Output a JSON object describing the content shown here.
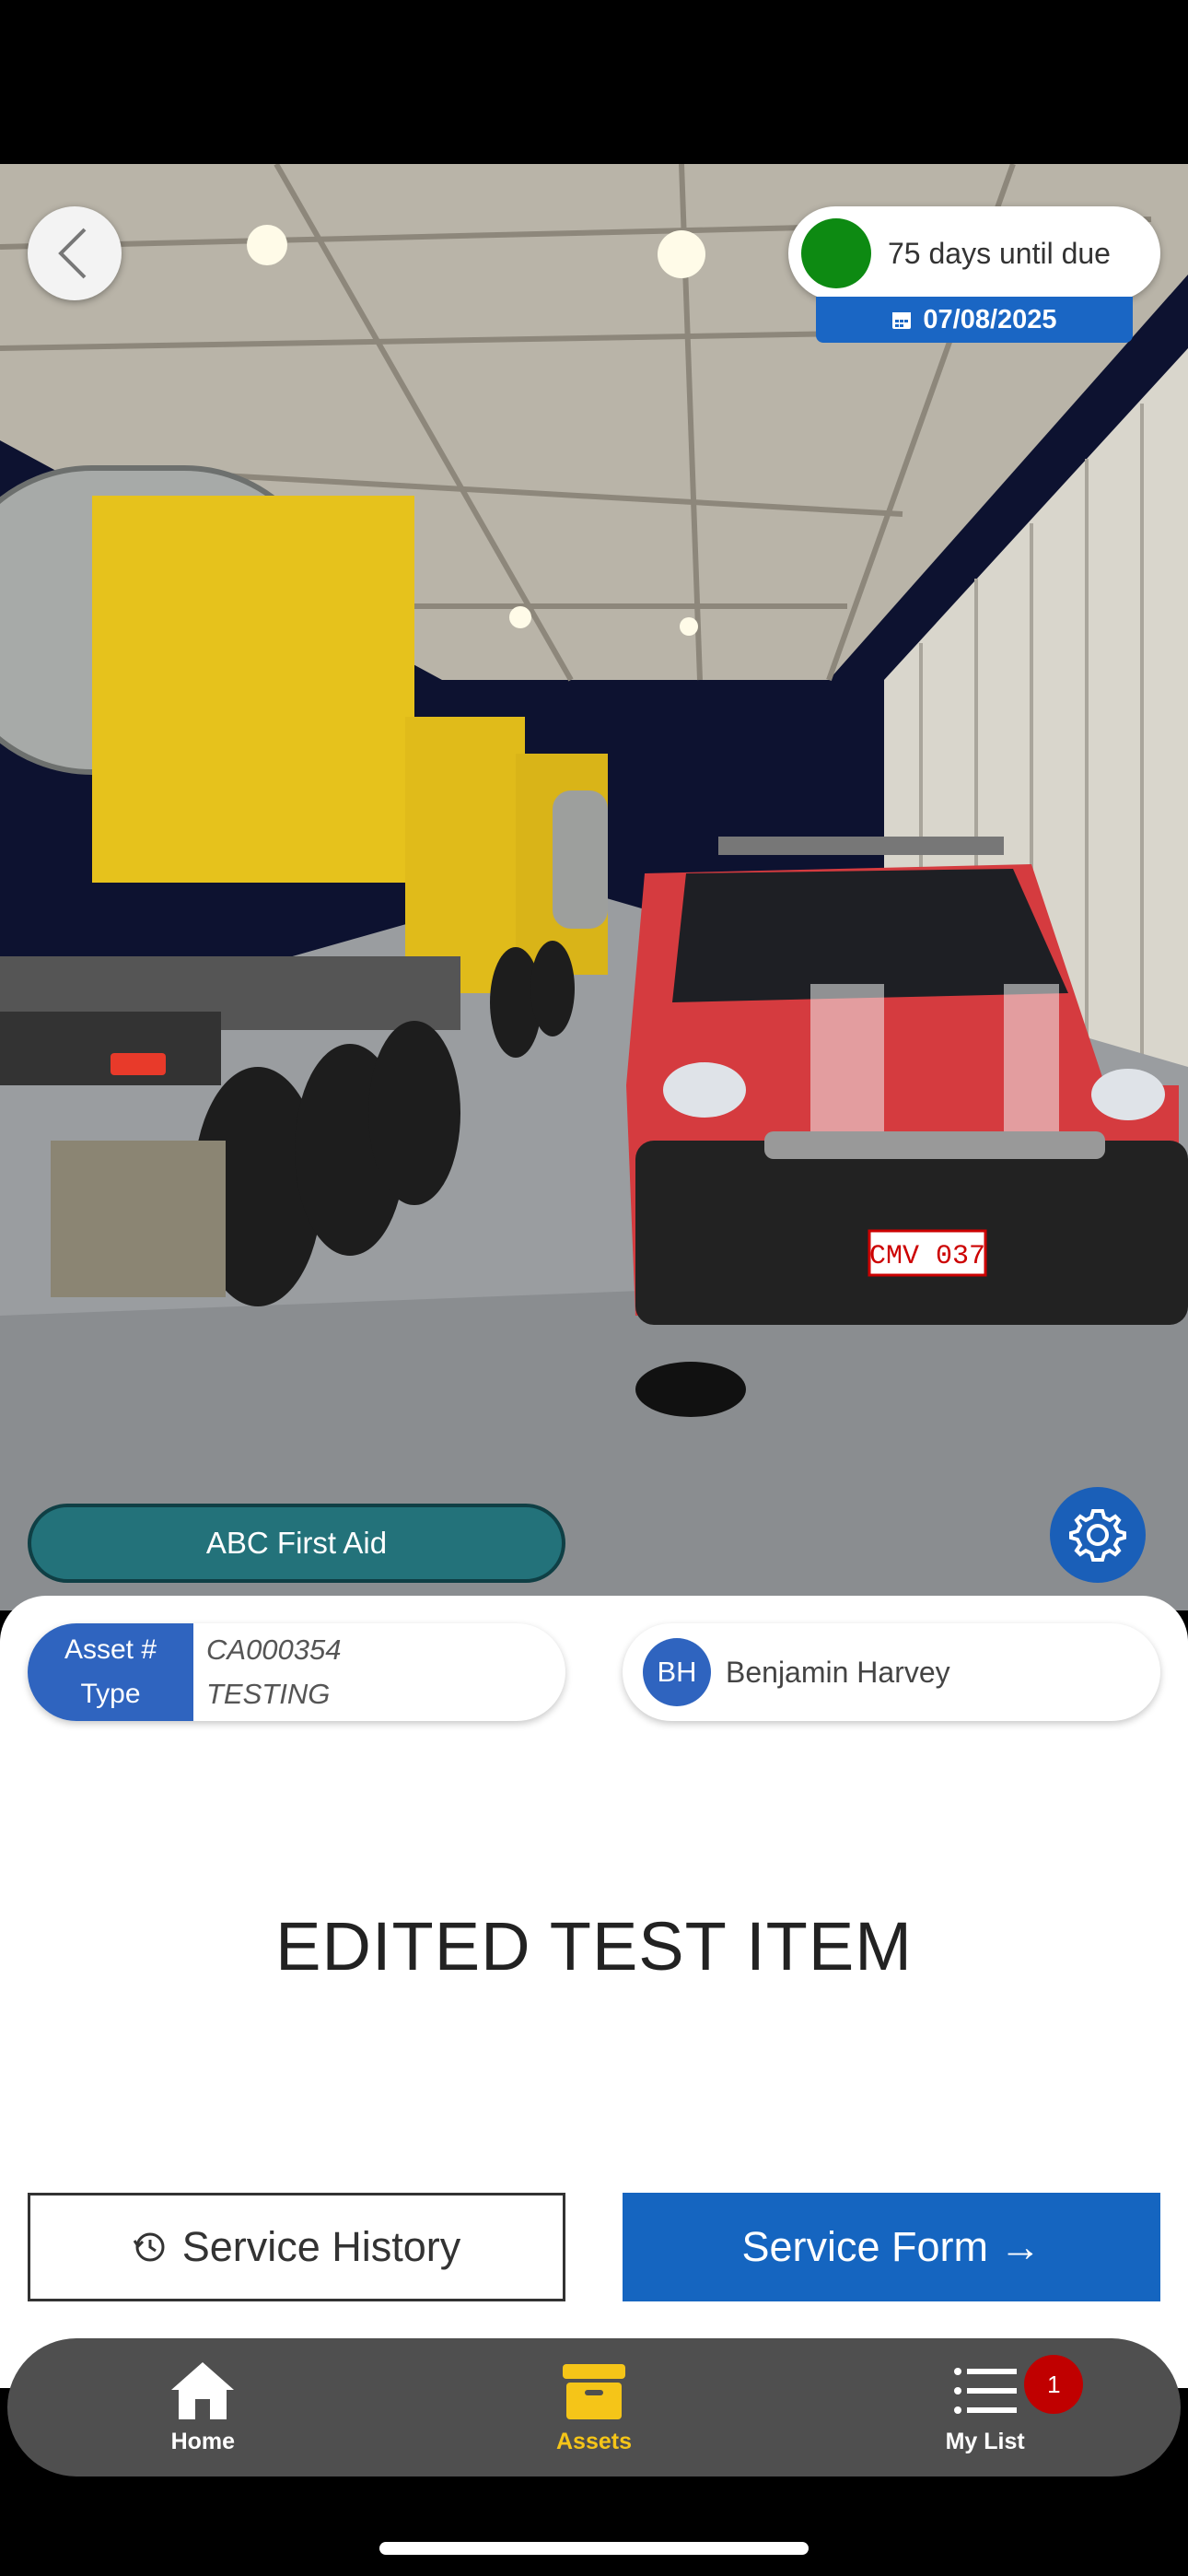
{
  "header": {
    "back_icon": "chevron-left-icon"
  },
  "due": {
    "status_color": "#0d8a12",
    "text": "75 days until due",
    "date": "07/08/2025",
    "date_icon": "calendar-icon"
  },
  "asset": {
    "category": "ABC First Aid",
    "asset_label": "Asset #",
    "asset_value": "CA000354",
    "type_label": "Type",
    "type_value": "TESTING",
    "title": "EDITED TEST ITEM"
  },
  "assignee": {
    "initials": "BH",
    "name": "Benjamin Harvey"
  },
  "actions": {
    "history_label": "Service History",
    "form_label": "Service Form →"
  },
  "nav": {
    "items": [
      {
        "label": "Home",
        "icon": "home-icon"
      },
      {
        "label": "Assets",
        "icon": "archive-box-icon",
        "active": true
      },
      {
        "label": "My List",
        "icon": "list-icon",
        "badge": "1"
      }
    ]
  },
  "photo": {
    "plate": "CMV 037"
  },
  "colors": {
    "accent_blue": "#1565c0",
    "category_teal": "#23727a",
    "active_nav": "#f5c518",
    "badge_red": "#c00000"
  }
}
